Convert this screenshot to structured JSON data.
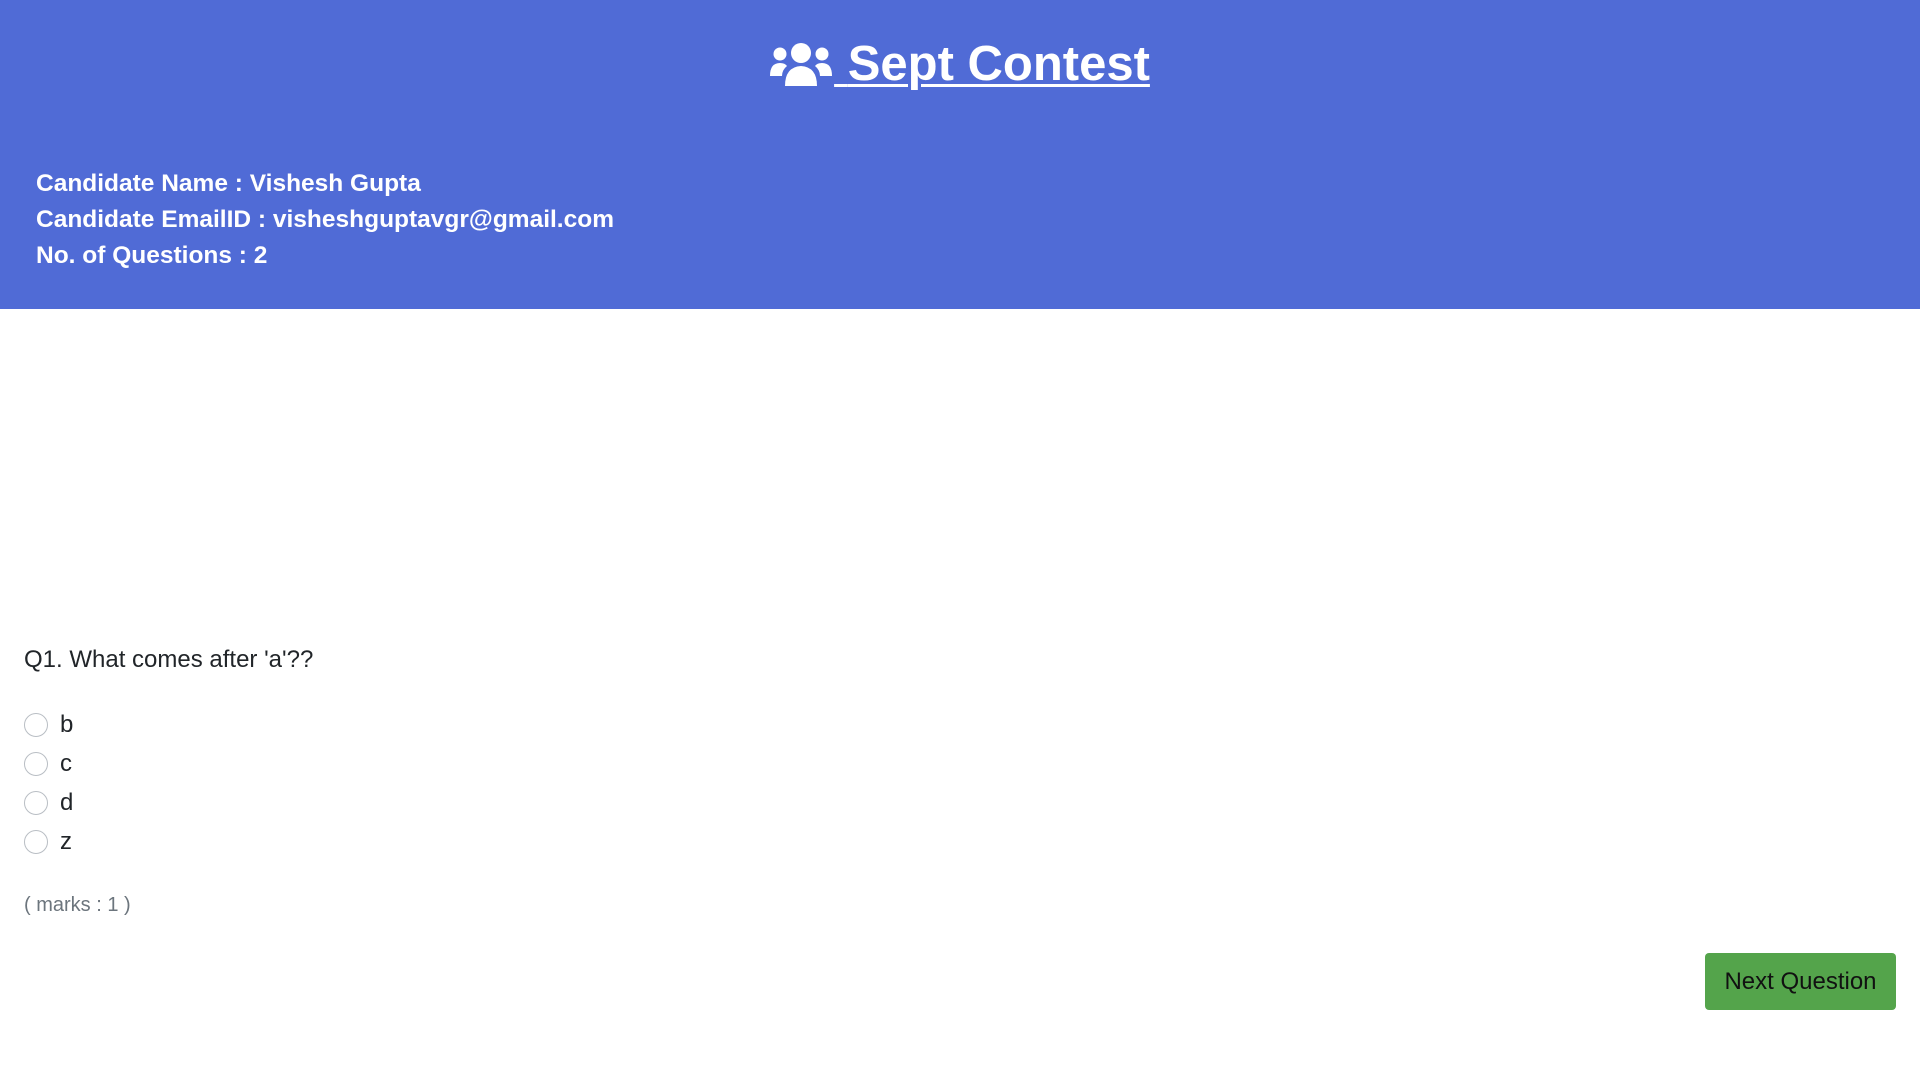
{
  "header": {
    "title": "Sept Contest",
    "title_icon": "users-icon",
    "background": "#506bd6",
    "candidate_name": "Candidate Name : Vishesh Gupta",
    "candidate_email": "Candidate EmailID : visheshguptavgr@gmail.com",
    "question_count": "No. of Questions : 2"
  },
  "question": {
    "text": "Q1. What comes after 'a'??",
    "options": [
      "b",
      "c",
      "d",
      "z"
    ],
    "marks": "( marks : 1 )"
  },
  "actions": {
    "next_label": "Next Question",
    "next_color": "#54a44b"
  }
}
